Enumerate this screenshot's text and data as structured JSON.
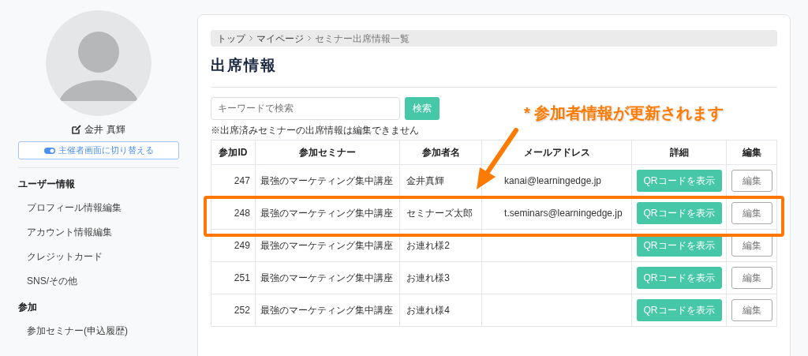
{
  "sidebar": {
    "user_name": "金井 真輝",
    "switch_button": "主催者画面に切り替える",
    "sections": [
      {
        "title": "ユーザー情報",
        "items": [
          "プロフィール情報編集",
          "アカウント情報編集",
          "クレジットカード",
          "SNS/その他"
        ]
      },
      {
        "title": "参加",
        "items": [
          "参加セミナー(申込履歴)"
        ]
      }
    ]
  },
  "breadcrumb": [
    "トップ",
    "マイページ",
    "セミナー出席情報一覧"
  ],
  "title": "出席情報",
  "search": {
    "placeholder": "キーワードで検索",
    "button": "検索"
  },
  "notice": "※出席済みセミナーの出席情報は編集できません",
  "table": {
    "columns": [
      "参加ID",
      "参加セミナー",
      "参加者名",
      "メールアドレス",
      "詳細",
      "編集"
    ],
    "rows": [
      {
        "id": "247",
        "seminar": "最強のマーケティング集中講座",
        "name": "金井真輝",
        "email": "kanai@learningedge.jp",
        "qr": "QRコードを表示",
        "edit": "編集",
        "highlighted": false
      },
      {
        "id": "248",
        "seminar": "最強のマーケティング集中講座",
        "name": "セミナーズ太郎",
        "email": "t.seminars@learningedge.jp",
        "qr": "QRコードを表示",
        "edit": "編集",
        "highlighted": true
      },
      {
        "id": "249",
        "seminar": "最強のマーケティング集中講座",
        "name": "お連れ様2",
        "qr": "QRコードを表示",
        "edit": "編集",
        "highlighted": false
      },
      {
        "id": "251",
        "seminar": "最強のマーケティング集中講座",
        "name": "お連れ様3",
        "qr": "QRコードを表示",
        "edit": "編集",
        "highlighted": false
      },
      {
        "id": "252",
        "seminar": "最強のマーケティング集中講座",
        "name": "お連れ様4",
        "qr": "QRコードを表示",
        "edit": "編集",
        "highlighted": false
      }
    ]
  },
  "annotation": "* 参加者情報が更新されます"
}
